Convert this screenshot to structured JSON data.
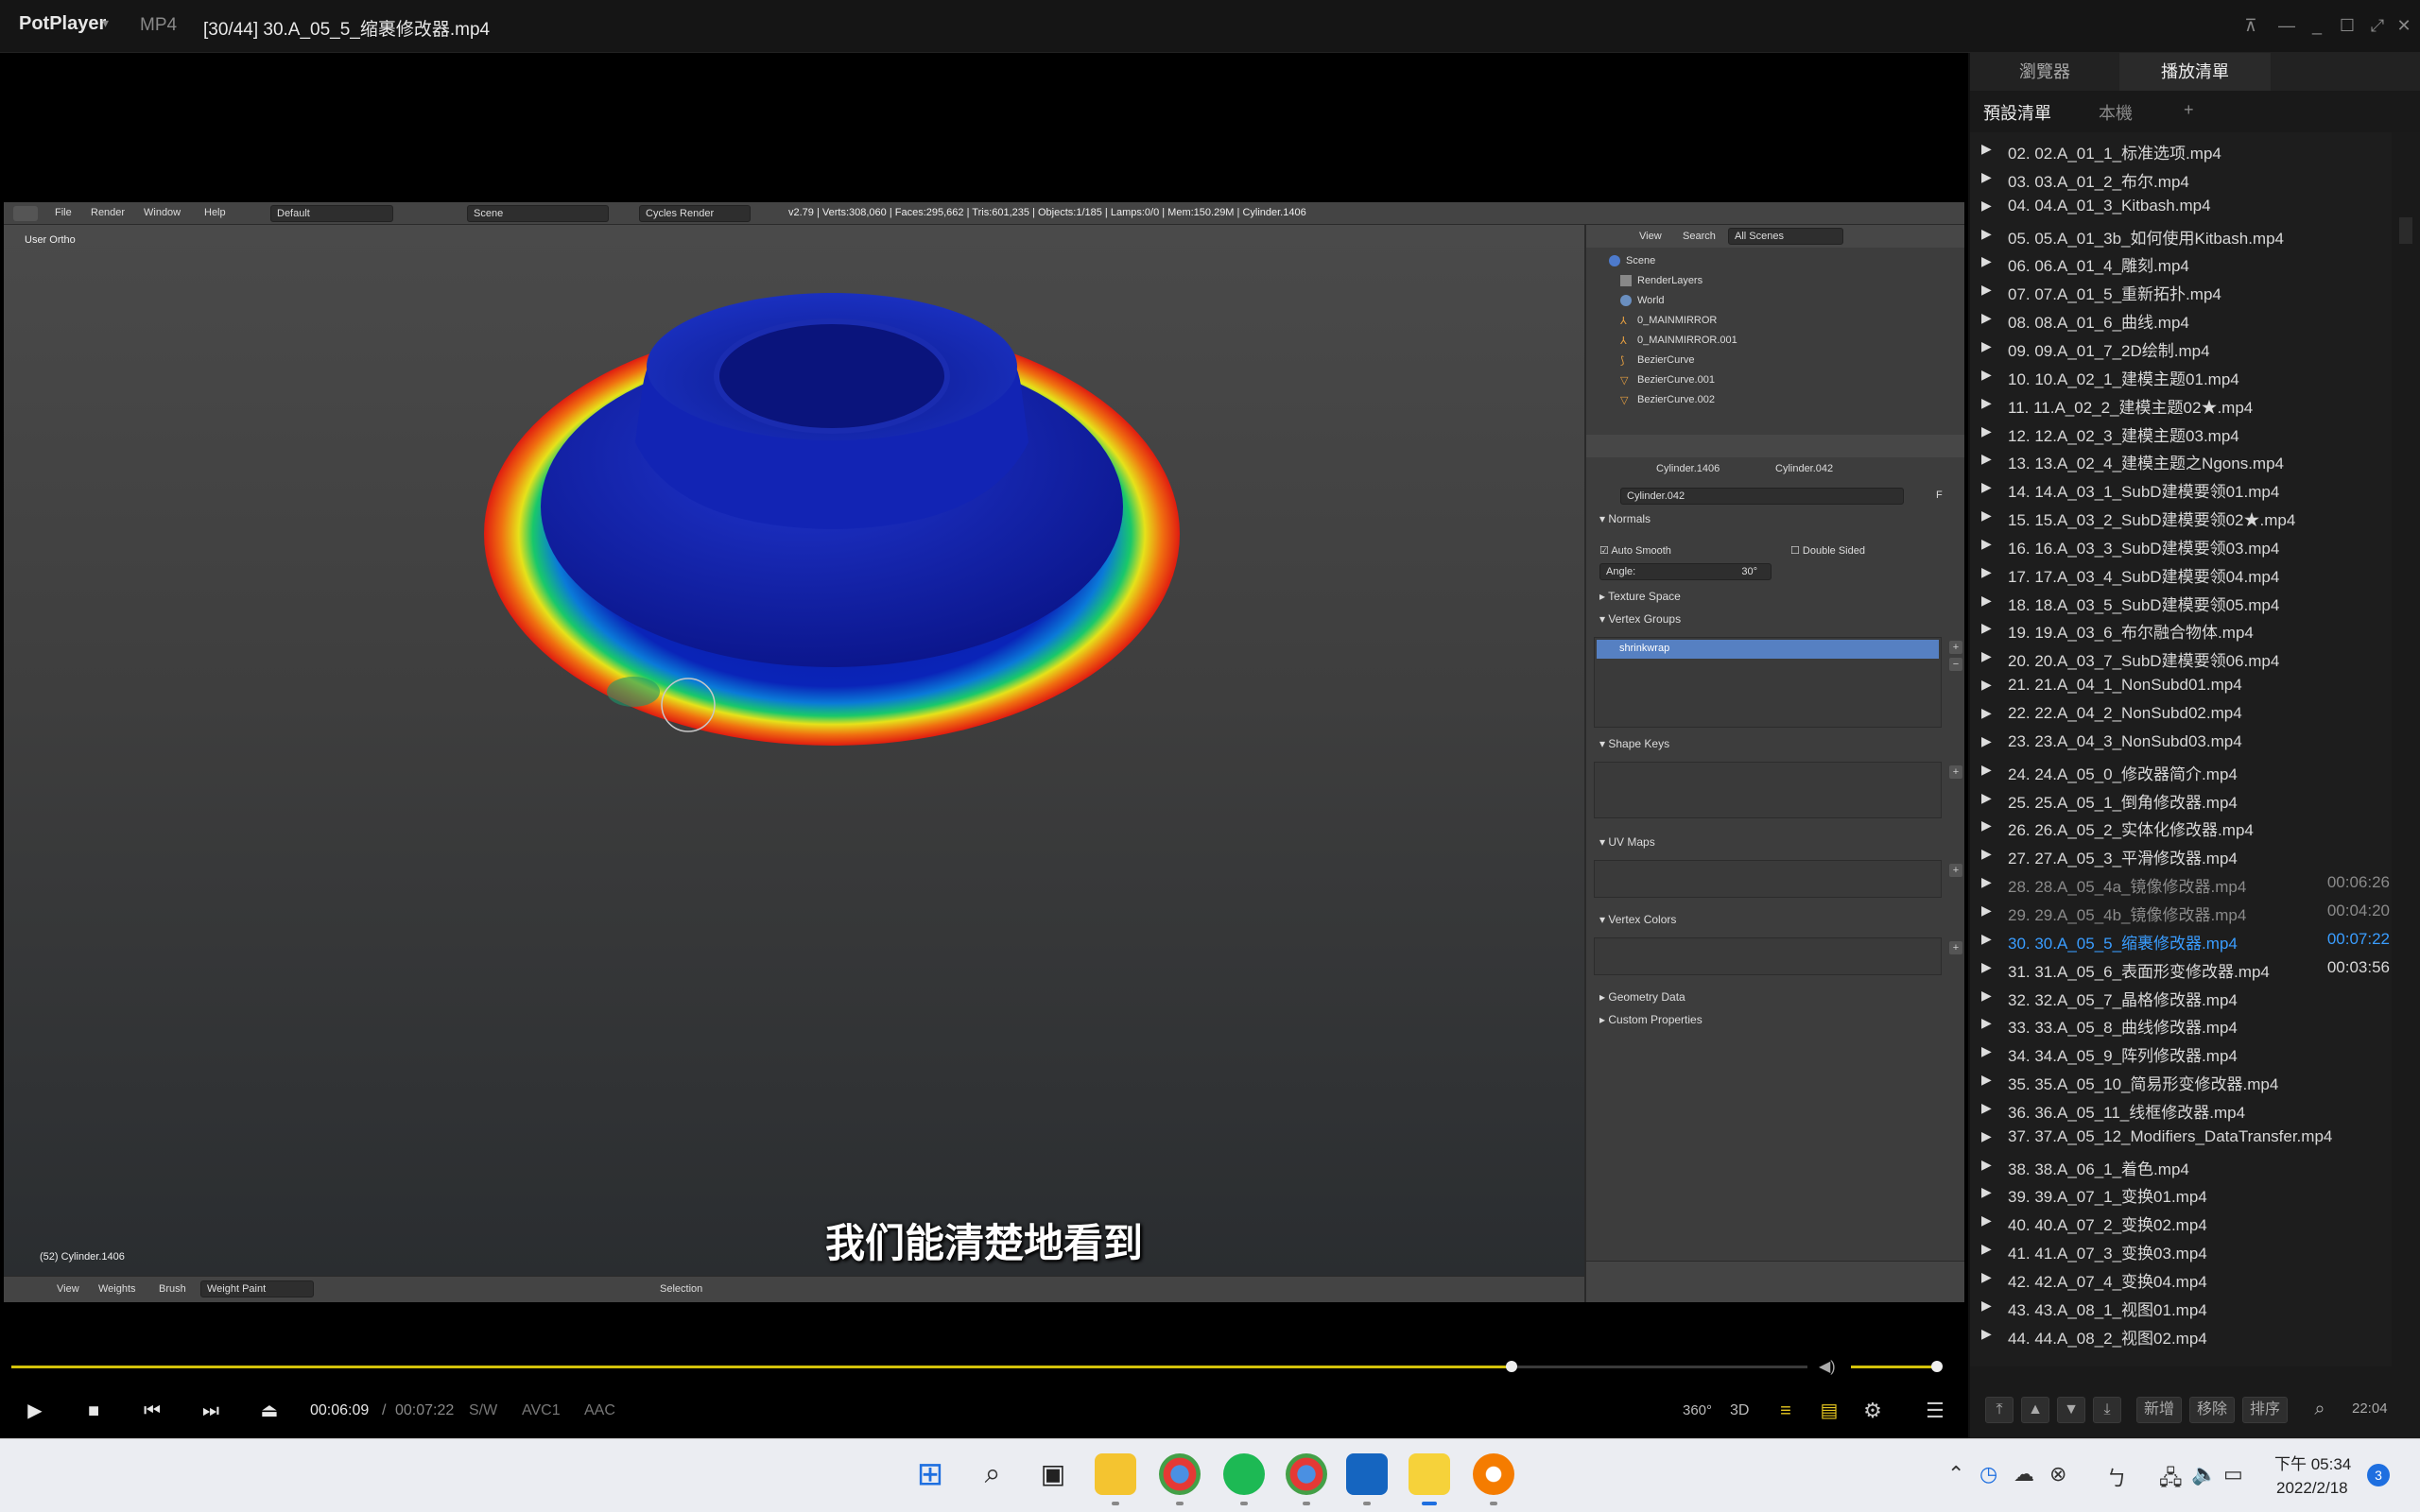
{
  "titlebar": {
    "brand": "PotPlayer",
    "format": "MP4",
    "title": "[30/44] 30.A_05_5_缩裹修改器.mp4"
  },
  "blender": {
    "menus": [
      "File",
      "Render",
      "Window",
      "Help"
    ],
    "layout": "Default",
    "scene": "Scene",
    "engine": "Cycles Render",
    "stats": "v2.79 | Verts:308,060 | Faces:295,662 | Tris:601,235 | Objects:1/185 | Lamps:0/0 | Mem:150.29M | Cylinder.1406",
    "viewport_label": "User Ortho",
    "object_label": "(52) Cylinder.1406",
    "footer": {
      "view": "View",
      "weights": "Weights",
      "brush": "Brush",
      "mode": "Weight Paint",
      "selection": "Selection"
    },
    "outliner": {
      "view": "View",
      "search": "Search",
      "filter": "All Scenes",
      "rows": [
        "Scene",
        "RenderLayers",
        "World",
        "0_MAINMIRROR",
        "0_MAINMIRROR.001",
        "BezierCurve",
        "BezierCurve.001",
        "BezierCurve.002"
      ]
    },
    "properties": {
      "breadcrumb_obj": "Cylinder.1406",
      "breadcrumb_mesh": "Cylinder.042",
      "mesh_name": "Cylinder.042",
      "fake_user": "F",
      "normals": "Normals",
      "auto_smooth": "Auto Smooth",
      "double_sided": "Double Sided",
      "angle_label": "Angle:",
      "angle_value": "30°",
      "texture_space": "Texture Space",
      "vertex_groups": "Vertex Groups",
      "vgroup_item": "shrinkwrap",
      "shape_keys": "Shape Keys",
      "uv_maps": "UV Maps",
      "vertex_colors": "Vertex Colors",
      "geometry_data": "Geometry Data",
      "custom_properties": "Custom Properties"
    }
  },
  "subtitle": "我们能清楚地看到",
  "controls": {
    "current_time": "00:06:09",
    "separator": "/",
    "total_time": "00:07:22",
    "sw": "S/W",
    "video_codec": "AVC1",
    "audio_codec": "AAC",
    "btn_360": "360°",
    "btn_3d": "3D",
    "progress": 0.835,
    "volume": 0.95
  },
  "playlist": {
    "tab_browser": "瀏覽器",
    "tab_playlist": "播放清單",
    "sub_default": "預設清單",
    "sub_local": "本機",
    "sub_add": "+",
    "items": [
      {
        "name": "02. 02.A_01_1_标准选项.mp4",
        "duration": ""
      },
      {
        "name": "03. 03.A_01_2_布尔.mp4",
        "duration": ""
      },
      {
        "name": "04. 04.A_01_3_Kitbash.mp4",
        "duration": ""
      },
      {
        "name": "05. 05.A_01_3b_如何使用Kitbash.mp4",
        "duration": ""
      },
      {
        "name": "06. 06.A_01_4_雕刻.mp4",
        "duration": ""
      },
      {
        "name": "07. 07.A_01_5_重新拓扑.mp4",
        "duration": ""
      },
      {
        "name": "08. 08.A_01_6_曲线.mp4",
        "duration": ""
      },
      {
        "name": "09. 09.A_01_7_2D绘制.mp4",
        "duration": ""
      },
      {
        "name": "10. 10.A_02_1_建模主题01.mp4",
        "duration": ""
      },
      {
        "name": "11. 11.A_02_2_建模主题02★.mp4",
        "duration": ""
      },
      {
        "name": "12. 12.A_02_3_建模主题03.mp4",
        "duration": ""
      },
      {
        "name": "13. 13.A_02_4_建模主题之Ngons.mp4",
        "duration": ""
      },
      {
        "name": "14. 14.A_03_1_SubD建模要领01.mp4",
        "duration": ""
      },
      {
        "name": "15. 15.A_03_2_SubD建模要领02★.mp4",
        "duration": ""
      },
      {
        "name": "16. 16.A_03_3_SubD建模要领03.mp4",
        "duration": ""
      },
      {
        "name": "17. 17.A_03_4_SubD建模要领04.mp4",
        "duration": ""
      },
      {
        "name": "18. 18.A_03_5_SubD建模要领05.mp4",
        "duration": ""
      },
      {
        "name": "19. 19.A_03_6_布尔融合物体.mp4",
        "duration": ""
      },
      {
        "name": "20. 20.A_03_7_SubD建模要领06.mp4",
        "duration": ""
      },
      {
        "name": "21. 21.A_04_1_NonSubd01.mp4",
        "duration": ""
      },
      {
        "name": "22. 22.A_04_2_NonSubd02.mp4",
        "duration": ""
      },
      {
        "name": "23. 23.A_04_3_NonSubd03.mp4",
        "duration": ""
      },
      {
        "name": "24. 24.A_05_0_修改器简介.mp4",
        "duration": ""
      },
      {
        "name": "25. 25.A_05_1_倒角修改器.mp4",
        "duration": ""
      },
      {
        "name": "26. 26.A_05_2_实体化修改器.mp4",
        "duration": ""
      },
      {
        "name": "27. 27.A_05_3_平滑修改器.mp4",
        "duration": ""
      },
      {
        "name": "28. 28.A_05_4a_镜像修改器.mp4",
        "duration": "00:06:26"
      },
      {
        "name": "29. 29.A_05_4b_镜像修改器.mp4",
        "duration": "00:04:20"
      },
      {
        "name": "30. 30.A_05_5_缩裹修改器.mp4",
        "duration": "00:07:22"
      },
      {
        "name": "31. 31.A_05_6_表面形变修改器.mp4",
        "duration": "00:03:56"
      },
      {
        "name": "32. 32.A_05_7_晶格修改器.mp4",
        "duration": ""
      },
      {
        "name": "33. 33.A_05_8_曲线修改器.mp4",
        "duration": ""
      },
      {
        "name": "34. 34.A_05_9_阵列修改器.mp4",
        "duration": ""
      },
      {
        "name": "35. 35.A_05_10_简易形变修改器.mp4",
        "duration": ""
      },
      {
        "name": "36. 36.A_05_11_线框修改器.mp4",
        "duration": ""
      },
      {
        "name": "37. 37.A_05_12_Modifiers_DataTransfer.mp4",
        "duration": ""
      },
      {
        "name": "38. 38.A_06_1_着色.mp4",
        "duration": ""
      },
      {
        "name": "39. 39.A_07_1_变换01.mp4",
        "duration": ""
      },
      {
        "name": "40. 40.A_07_2_变换02.mp4",
        "duration": ""
      },
      {
        "name": "41. 41.A_07_3_变换03.mp4",
        "duration": ""
      },
      {
        "name": "42. 42.A_07_4_变换04.mp4",
        "duration": ""
      },
      {
        "name": "43. 43.A_08_1_视图01.mp4",
        "duration": ""
      },
      {
        "name": "44. 44.A_08_2_视图02.mp4",
        "duration": ""
      }
    ],
    "btn_new": "新增",
    "btn_remove": "移除",
    "btn_sort": "排序",
    "total": "22:04"
  },
  "taskbar": {
    "time_line1": "下午 05:34",
    "time_line2": "2022/2/18",
    "notification_count": "3"
  }
}
